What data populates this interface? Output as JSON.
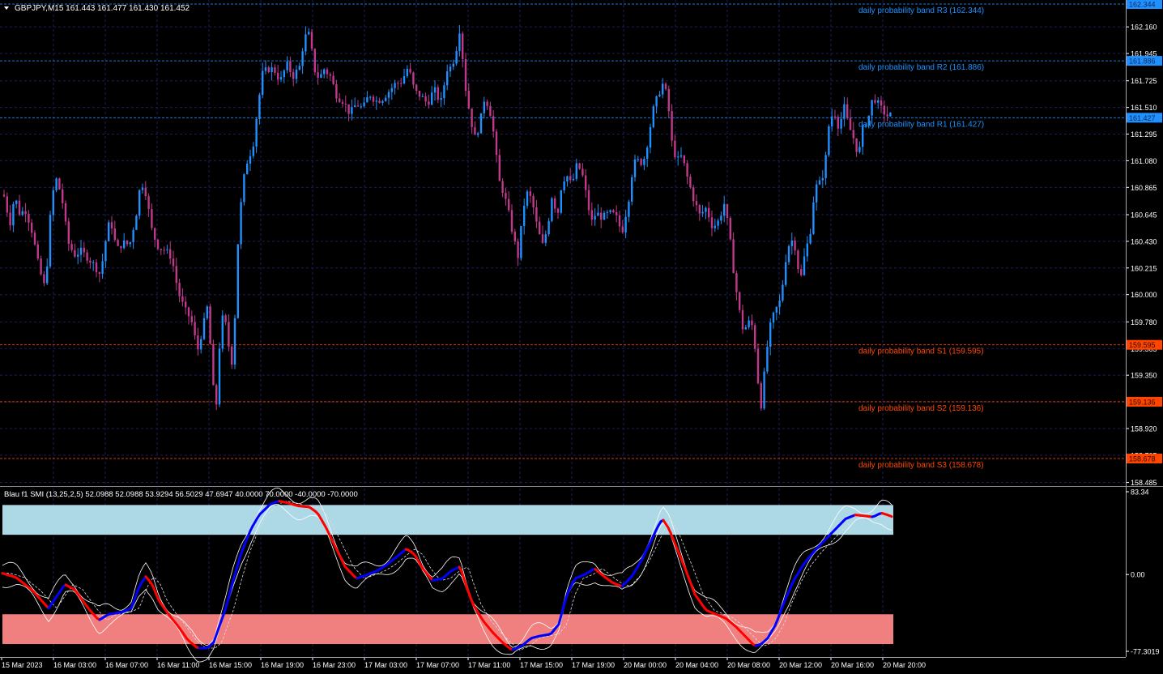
{
  "header": {
    "title": "GBPJPY,M15  161.443 161.477 161.430 161.452",
    "dropdown_icon": "triangle-down-icon"
  },
  "indicator": {
    "title": "Blau f1 SMI (13,25,2,5) 52.0988 52.0988 53.9294 56.5029 47.6947 40.0000 70.0000 -40.0000 -70.0000",
    "axis_labels": [
      {
        "label": "83.34",
        "value": 83.34
      },
      {
        "label": "0.00",
        "value": 0
      },
      {
        "label": "-77.3019",
        "value": -77.3019
      }
    ],
    "upper_zone": [
      40,
      70
    ],
    "lower_zone": [
      -70,
      -40
    ]
  },
  "price_axis": {
    "labels": [
      "162.160",
      "161.945",
      "161.725",
      "161.510",
      "161.295",
      "161.080",
      "160.865",
      "160.645",
      "160.430",
      "160.215",
      "160.000",
      "159.780",
      "159.565",
      "159.350",
      "159.135",
      "158.920",
      "158.705",
      "158.485"
    ]
  },
  "bands": [
    {
      "name": "R3",
      "label": "daily probability band R3 (162.344)",
      "tag": "162.344",
      "value": 162.344,
      "color": "#1e90ff",
      "tag_color": "#1e90ff"
    },
    {
      "name": "R2",
      "label": "daily probability band R2 (161.886)",
      "tag": "161.886",
      "value": 161.886,
      "color": "#1e90ff",
      "tag_color": "#1e90ff"
    },
    {
      "name": "R1",
      "label": "daily probability band R1 (161.427)",
      "tag": "161.427",
      "value": 161.427,
      "color": "#1e90ff",
      "tag_color": "#1e90ff"
    },
    {
      "name": "S1",
      "label": "daily probability band S1 (159.595)",
      "tag": "159.595",
      "value": 159.595,
      "color": "#ff4500",
      "tag_color": "#ff4500"
    },
    {
      "name": "S2",
      "label": "daily probability band S2 (159.136)",
      "tag": "159.136",
      "value": 159.136,
      "color": "#ff4500",
      "tag_color": "#ff4500"
    },
    {
      "name": "S3",
      "label": "daily probability band S3 (158.678)",
      "tag": "158.678",
      "value": 158.678,
      "color": "#ff4500",
      "tag_color": "#ff4500"
    }
  ],
  "time_axis": {
    "labels": [
      "15 Mar 2023",
      "16 Mar 03:00",
      "16 Mar 07:00",
      "16 Mar 11:00",
      "16 Mar 15:00",
      "16 Mar 19:00",
      "16 Mar 23:00",
      "17 Mar 03:00",
      "17 Mar 07:00",
      "17 Mar 11:00",
      "17 Mar 15:00",
      "17 Mar 19:00",
      "20 Mar 00:00",
      "20 Mar 04:00",
      "20 Mar 08:00",
      "20 Mar 12:00",
      "20 Mar 16:00",
      "20 Mar 20:00"
    ]
  },
  "colors": {
    "background": "#000000",
    "grid": "#1c1c5a",
    "bull": "#1e90ff",
    "bear": "#c0398a",
    "axis_text": "#ffffff",
    "zone_upper": "#add8e6",
    "zone_lower": "#f08080",
    "smi_up": "#0000ff",
    "smi_down": "#ff0000",
    "envelope": "#ffffff"
  },
  "chart_data": {
    "type": "candlestick",
    "symbol": "GBPJPY",
    "timeframe": "M15",
    "ylim": [
      158.485,
      162.344
    ],
    "price_path": [
      [
        0,
        160.86
      ],
      [
        6,
        160.78
      ],
      [
        12,
        160.56
      ],
      [
        18,
        160.8
      ],
      [
        24,
        160.66
      ],
      [
        32,
        160.68
      ],
      [
        40,
        160.5
      ],
      [
        48,
        160.22
      ],
      [
        56,
        160.04
      ],
      [
        62,
        160.62
      ],
      [
        68,
        160.96
      ],
      [
        76,
        160.8
      ],
      [
        84,
        160.42
      ],
      [
        92,
        160.32
      ],
      [
        100,
        160.35
      ],
      [
        108,
        160.3
      ],
      [
        116,
        160.24
      ],
      [
        124,
        160.16
      ],
      [
        130,
        160.42
      ],
      [
        136,
        160.62
      ],
      [
        144,
        160.36
      ],
      [
        152,
        160.42
      ],
      [
        160,
        160.4
      ],
      [
        168,
        160.64
      ],
      [
        174,
        160.92
      ],
      [
        180,
        160.82
      ],
      [
        188,
        160.5
      ],
      [
        196,
        160.38
      ],
      [
        204,
        160.36
      ],
      [
        212,
        160.3
      ],
      [
        220,
        160.02
      ],
      [
        228,
        159.88
      ],
      [
        236,
        159.8
      ],
      [
        244,
        159.55
      ],
      [
        250,
        159.72
      ],
      [
        256,
        159.9
      ],
      [
        262,
        159.4
      ],
      [
        266,
        158.95
      ],
      [
        270,
        159.52
      ],
      [
        276,
        159.88
      ],
      [
        282,
        159.6
      ],
      [
        288,
        159.4
      ],
      [
        292,
        160.25
      ],
      [
        296,
        160.62
      ],
      [
        300,
        160.9
      ],
      [
        306,
        161.1
      ],
      [
        312,
        161.18
      ],
      [
        318,
        161.5
      ],
      [
        324,
        161.78
      ],
      [
        330,
        161.82
      ],
      [
        338,
        161.82
      ],
      [
        346,
        161.72
      ],
      [
        354,
        161.86
      ],
      [
        362,
        161.76
      ],
      [
        370,
        161.84
      ],
      [
        376,
        162.08
      ],
      [
        382,
        162.1
      ],
      [
        388,
        161.82
      ],
      [
        394,
        161.74
      ],
      [
        400,
        161.82
      ],
      [
        408,
        161.76
      ],
      [
        416,
        161.6
      ],
      [
        424,
        161.56
      ],
      [
        432,
        161.46
      ],
      [
        440,
        161.54
      ],
      [
        448,
        161.5
      ],
      [
        456,
        161.62
      ],
      [
        464,
        161.56
      ],
      [
        472,
        161.58
      ],
      [
        480,
        161.64
      ],
      [
        488,
        161.7
      ],
      [
        496,
        161.72
      ],
      [
        504,
        161.84
      ],
      [
        512,
        161.64
      ],
      [
        520,
        161.6
      ],
      [
        528,
        161.54
      ],
      [
        536,
        161.66
      ],
      [
        544,
        161.54
      ],
      [
        552,
        161.82
      ],
      [
        558,
        161.84
      ],
      [
        564,
        162.0
      ],
      [
        568,
        162.16
      ],
      [
        574,
        161.7
      ],
      [
        580,
        161.46
      ],
      [
        586,
        161.26
      ],
      [
        592,
        161.36
      ],
      [
        598,
        161.58
      ],
      [
        604,
        161.52
      ],
      [
        610,
        161.28
      ],
      [
        616,
        160.92
      ],
      [
        622,
        160.82
      ],
      [
        628,
        160.66
      ],
      [
        634,
        160.46
      ],
      [
        640,
        160.3
      ],
      [
        646,
        160.7
      ],
      [
        652,
        160.84
      ],
      [
        658,
        160.72
      ],
      [
        664,
        160.52
      ],
      [
        670,
        160.4
      ],
      [
        676,
        160.54
      ],
      [
        682,
        160.82
      ],
      [
        688,
        160.62
      ],
      [
        694,
        160.92
      ],
      [
        700,
        160.96
      ],
      [
        706,
        160.88
      ],
      [
        712,
        161.04
      ],
      [
        718,
        161.0
      ],
      [
        724,
        160.8
      ],
      [
        730,
        160.58
      ],
      [
        736,
        160.66
      ],
      [
        744,
        160.62
      ],
      [
        752,
        160.66
      ],
      [
        760,
        160.64
      ],
      [
        768,
        160.5
      ],
      [
        776,
        160.76
      ],
      [
        782,
        161.06
      ],
      [
        788,
        161.08
      ],
      [
        794,
        161.06
      ],
      [
        800,
        161.24
      ],
      [
        806,
        161.48
      ],
      [
        812,
        161.6
      ],
      [
        818,
        161.7
      ],
      [
        824,
        161.6
      ],
      [
        830,
        161.2
      ],
      [
        836,
        161.08
      ],
      [
        842,
        161.12
      ],
      [
        848,
        160.96
      ],
      [
        856,
        160.78
      ],
      [
        864,
        160.64
      ],
      [
        872,
        160.7
      ],
      [
        880,
        160.54
      ],
      [
        888,
        160.6
      ],
      [
        894,
        160.74
      ],
      [
        900,
        160.52
      ],
      [
        906,
        160.18
      ],
      [
        912,
        159.9
      ],
      [
        918,
        159.7
      ],
      [
        924,
        159.78
      ],
      [
        930,
        159.74
      ],
      [
        936,
        159.3
      ],
      [
        940,
        159.1
      ],
      [
        946,
        159.52
      ],
      [
        952,
        159.78
      ],
      [
        958,
        159.88
      ],
      [
        964,
        159.96
      ],
      [
        970,
        160.28
      ],
      [
        976,
        160.46
      ],
      [
        982,
        160.38
      ],
      [
        988,
        160.1
      ],
      [
        994,
        160.34
      ],
      [
        1000,
        160.48
      ],
      [
        1006,
        160.86
      ],
      [
        1012,
        160.9
      ],
      [
        1018,
        161.0
      ],
      [
        1024,
        161.4
      ],
      [
        1030,
        161.48
      ],
      [
        1036,
        161.34
      ],
      [
        1042,
        161.52
      ],
      [
        1048,
        161.36
      ],
      [
        1054,
        161.26
      ],
      [
        1060,
        161.12
      ],
      [
        1066,
        161.36
      ],
      [
        1072,
        161.42
      ],
      [
        1078,
        161.6
      ],
      [
        1084,
        161.54
      ],
      [
        1090,
        161.48
      ],
      [
        1096,
        161.44
      ],
      [
        1101,
        161.452
      ]
    ],
    "smi_path": [
      [
        0,
        2
      ],
      [
        20,
        -3
      ],
      [
        40,
        -16
      ],
      [
        60,
        -34
      ],
      [
        70,
        -22
      ],
      [
        80,
        -10
      ],
      [
        92,
        -15
      ],
      [
        100,
        -24
      ],
      [
        110,
        -35
      ],
      [
        122,
        -46
      ],
      [
        134,
        -40
      ],
      [
        150,
        -38
      ],
      [
        162,
        -34
      ],
      [
        172,
        -12
      ],
      [
        180,
        -2
      ],
      [
        188,
        -10
      ],
      [
        196,
        -26
      ],
      [
        208,
        -40
      ],
      [
        220,
        -52
      ],
      [
        232,
        -66
      ],
      [
        244,
        -74
      ],
      [
        256,
        -74
      ],
      [
        264,
        -68
      ],
      [
        270,
        -54
      ],
      [
        278,
        -36
      ],
      [
        288,
        -6
      ],
      [
        298,
        22
      ],
      [
        310,
        46
      ],
      [
        320,
        60
      ],
      [
        334,
        71
      ],
      [
        344,
        74
      ],
      [
        356,
        72
      ],
      [
        368,
        69
      ],
      [
        382,
        68
      ],
      [
        392,
        62
      ],
      [
        402,
        48
      ],
      [
        414,
        28
      ],
      [
        426,
        8
      ],
      [
        440,
        -4
      ],
      [
        454,
        0
      ],
      [
        466,
        4
      ],
      [
        478,
        10
      ],
      [
        490,
        18
      ],
      [
        502,
        26
      ],
      [
        512,
        20
      ],
      [
        522,
        6
      ],
      [
        534,
        -6
      ],
      [
        546,
        -4
      ],
      [
        558,
        4
      ],
      [
        568,
        8
      ],
      [
        576,
        -12
      ],
      [
        584,
        -30
      ],
      [
        596,
        -46
      ],
      [
        608,
        -58
      ],
      [
        620,
        -68
      ],
      [
        632,
        -76
      ],
      [
        644,
        -72
      ],
      [
        656,
        -64
      ],
      [
        666,
        -62
      ],
      [
        680,
        -60
      ],
      [
        690,
        -50
      ],
      [
        700,
        -20
      ],
      [
        710,
        -4
      ],
      [
        722,
        0
      ],
      [
        734,
        6
      ],
      [
        746,
        -2
      ],
      [
        756,
        -8
      ],
      [
        768,
        -12
      ],
      [
        780,
        -2
      ],
      [
        792,
        14
      ],
      [
        804,
        34
      ],
      [
        812,
        48
      ],
      [
        818,
        56
      ],
      [
        826,
        46
      ],
      [
        834,
        30
      ],
      [
        846,
        6
      ],
      [
        858,
        -20
      ],
      [
        872,
        -36
      ],
      [
        884,
        -40
      ],
      [
        896,
        -44
      ],
      [
        908,
        -52
      ],
      [
        920,
        -62
      ],
      [
        932,
        -72
      ],
      [
        940,
        -70
      ],
      [
        948,
        -64
      ],
      [
        958,
        -50
      ],
      [
        968,
        -28
      ],
      [
        980,
        -6
      ],
      [
        992,
        10
      ],
      [
        1006,
        24
      ],
      [
        1020,
        36
      ],
      [
        1032,
        46
      ],
      [
        1044,
        56
      ],
      [
        1056,
        60
      ],
      [
        1068,
        59
      ],
      [
        1078,
        58
      ],
      [
        1088,
        62
      ],
      [
        1096,
        60
      ],
      [
        1102,
        58
      ]
    ]
  }
}
